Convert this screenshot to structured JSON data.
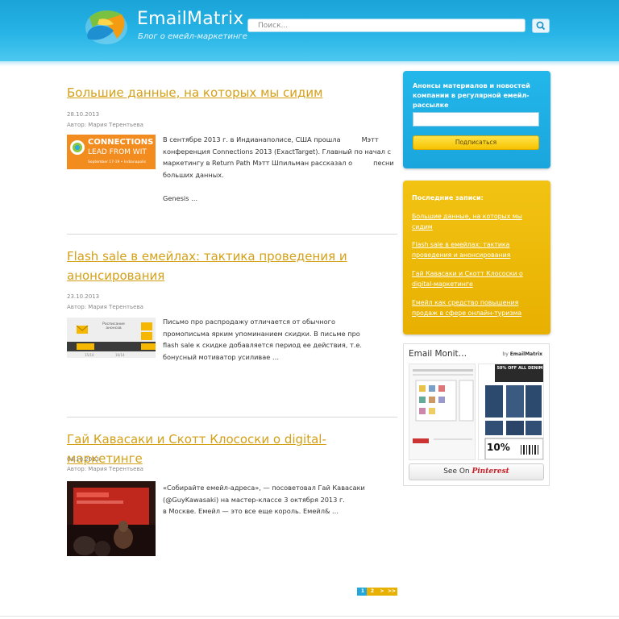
{
  "header": {
    "site_title": "EmailMatrix",
    "tagline": "Блог о емейл-маркетинге",
    "search_placeholder": "Поиск..."
  },
  "posts": [
    {
      "title": "Большие данные, на которых мы сидим",
      "date": "28.10.2013",
      "author": "Автор: Мария Терентьева",
      "excerpt": "В сентябре 2013 г. в Индианаполисе, США прошла          Мэтт\nконференция Connections 2013 (ExactTarget). Главный по начал с\nмаркетингу в Return Path Мэтт Шпильман рассказал о          песни\nбольших данных.\n\nGenesis …",
      "thumb_text": "CONNECTIONS",
      "thumb_subtext": "LEAD FROM WIT",
      "thumb_small": "September 17-19 • Indianapolis"
    },
    {
      "title": "Flash sale в емейлах: тактика проведения и анонсирования",
      "date": "23.10.2013",
      "author": "Автор: Мария Терентьева",
      "excerpt": "Письмо про распродажу отличается от обычного\nпромописьма ярким упоминанием скидки. В письме про\nflash sale к скидке добавляется период ее действия, т.е.\nбонусный мотиватор усиливае …",
      "thumb_text": "Расписание анонсов"
    },
    {
      "title": "Гай Кавасаки и Скотт Клососки о digital-маркетинге",
      "date": "04.10.2013",
      "author": "Автор: Мария Терентьева",
      "excerpt": "«Собирайте емейл-адреса», — посоветовал Гай Кавасаки\n(@GuyKawasaki) на мастер-классе 3 октября 2013 г.\nв Москве. Емейл — это все еще король. Емейл& …"
    }
  ],
  "sidebar": {
    "subscribe_text": "Анонсы материалов и новостей компании в регулярной емейл-рассылке",
    "subscribe_button": "Подписаться",
    "recent_heading": "Последние записи:",
    "recent_links": [
      "Большие данные, на которых мы сидим",
      "Flash sale в емейлах: тактика проведения и анонсирования",
      "Гай Кавасаки и Скотт Клососки о digital-маркетинге",
      "Емейл как средство повышения продаж в сфере онлайн-туризма"
    ],
    "pinterest": {
      "title": "Email Monit…",
      "by": "by",
      "by_name": "EmailMatrix",
      "see_on": "See On",
      "brand": "Pinterest",
      "ad_text_1": "50% OFF ALL DENIM",
      "ad_text_2": "10%"
    }
  },
  "pagination": [
    "1",
    "2",
    ">",
    ">>"
  ],
  "colors": {
    "accent_blue": "#27b4e6",
    "accent_gold": "#e8b000",
    "link_gold": "#d4a017"
  }
}
